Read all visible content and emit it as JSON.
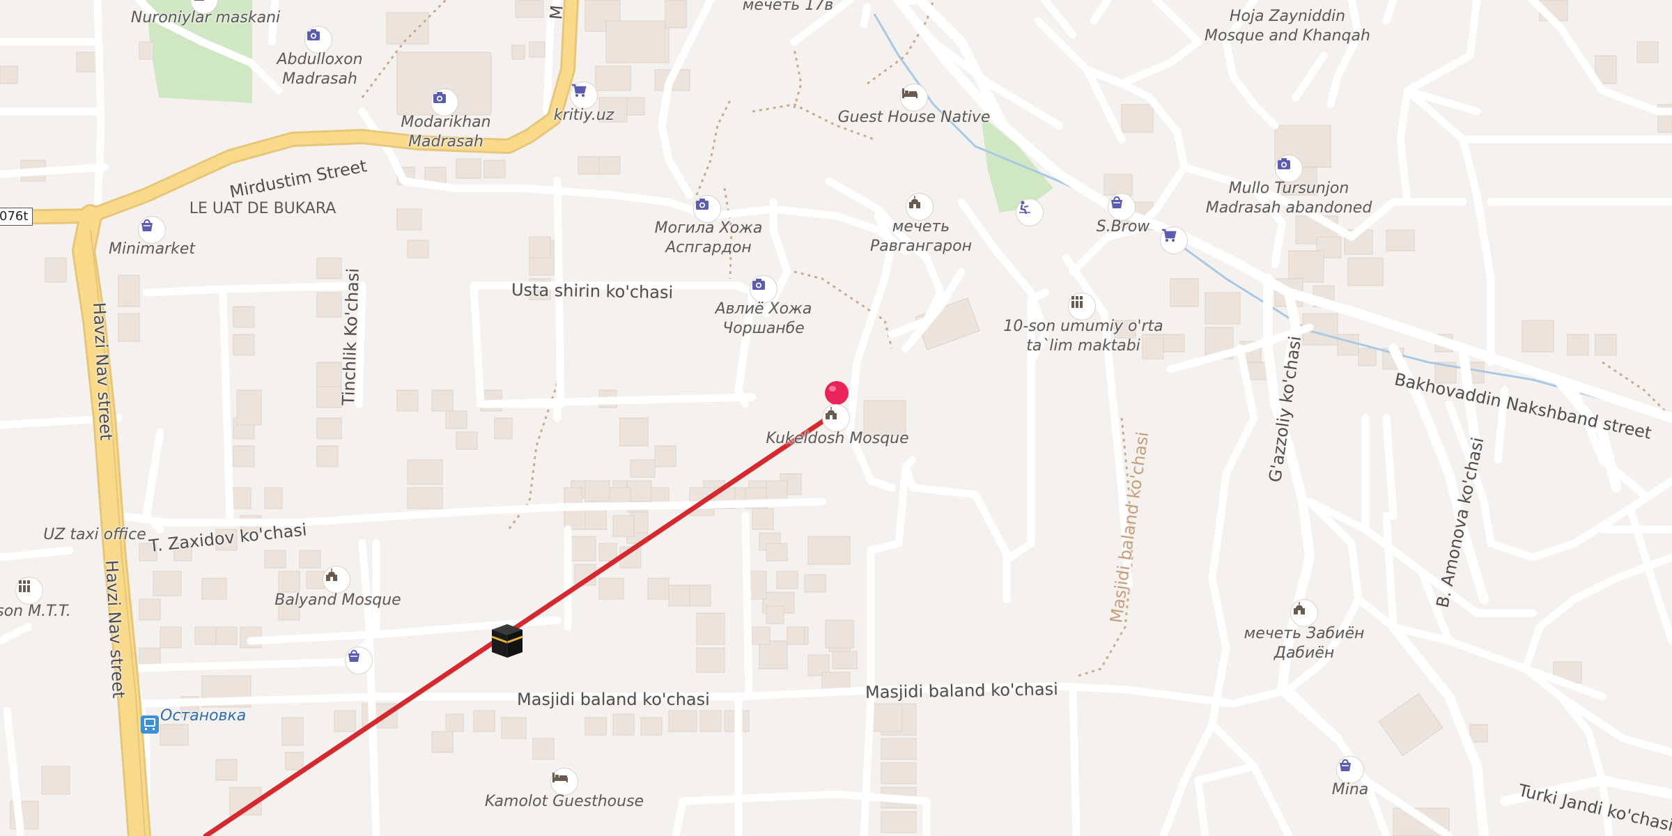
{
  "map": {
    "road_shield": "076t",
    "streets": [
      {
        "id": "mirdustim",
        "text": "Mirdustim Street"
      },
      {
        "id": "havzi1",
        "text": "Havzi Nav street"
      },
      {
        "id": "havzi2",
        "text": "Havzi Nav street"
      },
      {
        "id": "tinchlik",
        "text": "Tinchlik Ko'chasi"
      },
      {
        "id": "usta",
        "text": "Usta shirin ko'chasi"
      },
      {
        "id": "zaxidov",
        "text": "T. Zaxidov ko'chasi"
      },
      {
        "id": "masjidi1",
        "text": "Masjidi baland ko'chasi"
      },
      {
        "id": "masjidi2",
        "text": "Masjidi baland ko'chasi"
      },
      {
        "id": "masjidi3",
        "text": "Masjidi baland ko'chasi"
      },
      {
        "id": "gazzoliy",
        "text": "G'azzoliy ko'chasi"
      },
      {
        "id": "bakhovaddin",
        "text": "Bakhovaddin Nakshband street"
      },
      {
        "id": "amonova",
        "text": "B. Amonova ko'chasi"
      },
      {
        "id": "turki",
        "text": "Turki Jandi ko'chasi"
      },
      {
        "id": "top",
        "text": "M"
      }
    ],
    "places": [
      {
        "id": "nuroniylar",
        "text": "Nuroniylar maskani",
        "icon": "monument-icon"
      },
      {
        "id": "abdulloxon",
        "text": "Abdulloxon\nMadrasah",
        "icon": "camera-icon"
      },
      {
        "id": "modarikhan",
        "text": "Modarikhan\nMadrasah",
        "icon": "camera-icon"
      },
      {
        "id": "kritiy",
        "text": "kritiy.uz",
        "icon": "cart-icon"
      },
      {
        "id": "mechet17",
        "text": "мечеть 17в",
        "icon": ""
      },
      {
        "id": "guesthouse",
        "text": "Guest House Native",
        "icon": "bed-icon"
      },
      {
        "id": "hoja",
        "text": "Hoja Zayniddin\nMosque and Khanqah",
        "icon": ""
      },
      {
        "id": "mullo",
        "text": "Mullo Tursunjon\nMadrasah abandoned",
        "icon": "camera-icon"
      },
      {
        "id": "sbrow",
        "text": "S.Brow",
        "icon": "shopping-bag-icon"
      },
      {
        "id": "lebuk",
        "text": "LE UAT DE BUKARA",
        "icon": ""
      },
      {
        "id": "minimarket",
        "text": "Minimarket",
        "icon": "shopping-bag-icon"
      },
      {
        "id": "mogila",
        "text": "Могила Хожа\nАспгардон",
        "icon": "camera-icon"
      },
      {
        "id": "ravgan",
        "text": "мечеть\nРавгангарон",
        "icon": "mosque-icon"
      },
      {
        "id": "avliyo",
        "text": "Авлиё Хожа\nЧоршанбе",
        "icon": "camera-icon"
      },
      {
        "id": "maktabi",
        "text": "10-son umumiy o'rta\nta`lim maktabi",
        "icon": "school-icon"
      },
      {
        "id": "kukeldosh",
        "text": "Kukeldosh Mosque",
        "icon": "mosque-icon"
      },
      {
        "id": "uztaxi",
        "text": "UZ taxi office",
        "icon": ""
      },
      {
        "id": "balyand",
        "text": "Balyand Mosque",
        "icon": "mosque-icon"
      },
      {
        "id": "mtt",
        "text": "son M.T.T.",
        "icon": "school-icon"
      },
      {
        "id": "ostanovka",
        "text": "Остановка",
        "icon": "bus-stop-icon"
      },
      {
        "id": "kamolot",
        "text": "Kamolot Guesthouse",
        "icon": "bed-icon"
      },
      {
        "id": "zabien",
        "text": "мечеть Забиён\nДабиён",
        "icon": "mosque-icon"
      },
      {
        "id": "mina",
        "text": "Mina",
        "icon": "shopping-bag-icon"
      }
    ],
    "extra_icons": [
      {
        "id": "shop-pin-1",
        "icon": "shopping-bag-icon"
      },
      {
        "id": "cart-2",
        "icon": "cart-icon"
      },
      {
        "id": "playground",
        "icon": "playground-icon"
      }
    ],
    "qibla_line_color": "#d42a2f",
    "pin_color": "#e8245b",
    "poi_icon_color": "#5b5bb0",
    "road_major_color": "#f9d98a"
  }
}
